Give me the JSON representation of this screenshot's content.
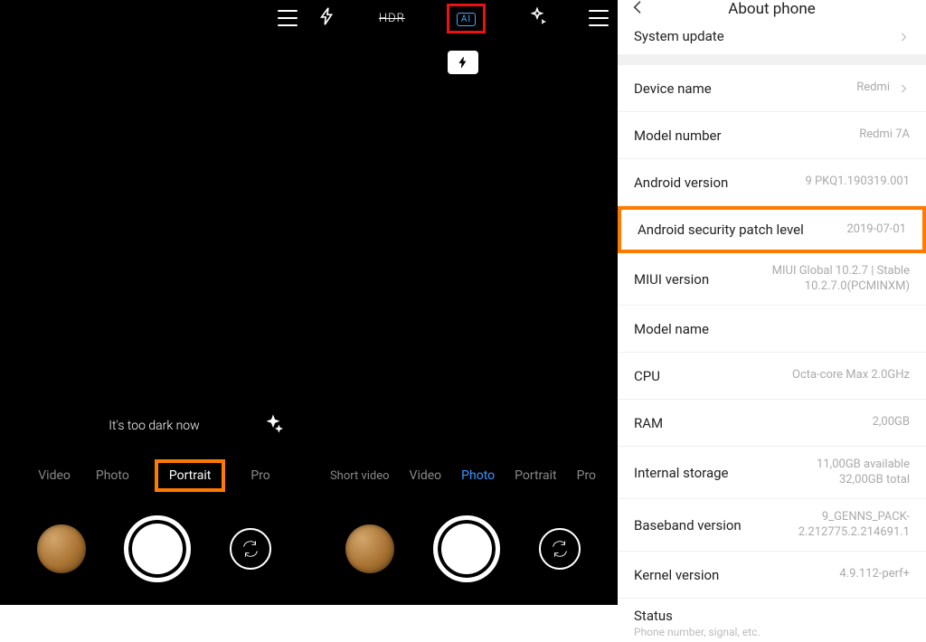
{
  "panel1": {
    "warning": "It's too dark now",
    "modes": [
      "Video",
      "Photo",
      "Portrait",
      "Pro"
    ]
  },
  "panel2": {
    "hdr_label": "HDR",
    "ai_label": "AI",
    "modes": [
      "Short video",
      "Video",
      "Photo",
      "Portrait",
      "Pro"
    ]
  },
  "panel3": {
    "title": "About phone",
    "rows": {
      "system_update": "System update",
      "device_name": {
        "label": "Device name",
        "value": "Redmi"
      },
      "model_number": {
        "label": "Model number",
        "value": "Redmi 7A"
      },
      "android_version": {
        "label": "Android version",
        "value": "9 PKQ1.190319.001"
      },
      "security_patch": {
        "label": "Android security patch level",
        "value": "2019-07-01"
      },
      "miui": {
        "label": "MIUI version",
        "value": "MIUI Global 10.2.7 | Stable 10.2.7.0(PCMINXM)"
      },
      "model_name": {
        "label": "Model name",
        "value": ""
      },
      "cpu": {
        "label": "CPU",
        "value": "Octa-core Max 2.0GHz"
      },
      "ram": {
        "label": "RAM",
        "value": "2,00GB"
      },
      "storage": {
        "label": "Internal storage",
        "value": "11,00GB available\n32,00GB total"
      },
      "baseband": {
        "label": "Baseband version",
        "value": "9_GENNS_PACK-2.212775.2.214691.1"
      },
      "kernel": {
        "label": "Kernel version",
        "value": "4.9.112-perf+"
      },
      "status": {
        "label": "Status",
        "sub": "Phone number, signal, etc."
      }
    }
  }
}
